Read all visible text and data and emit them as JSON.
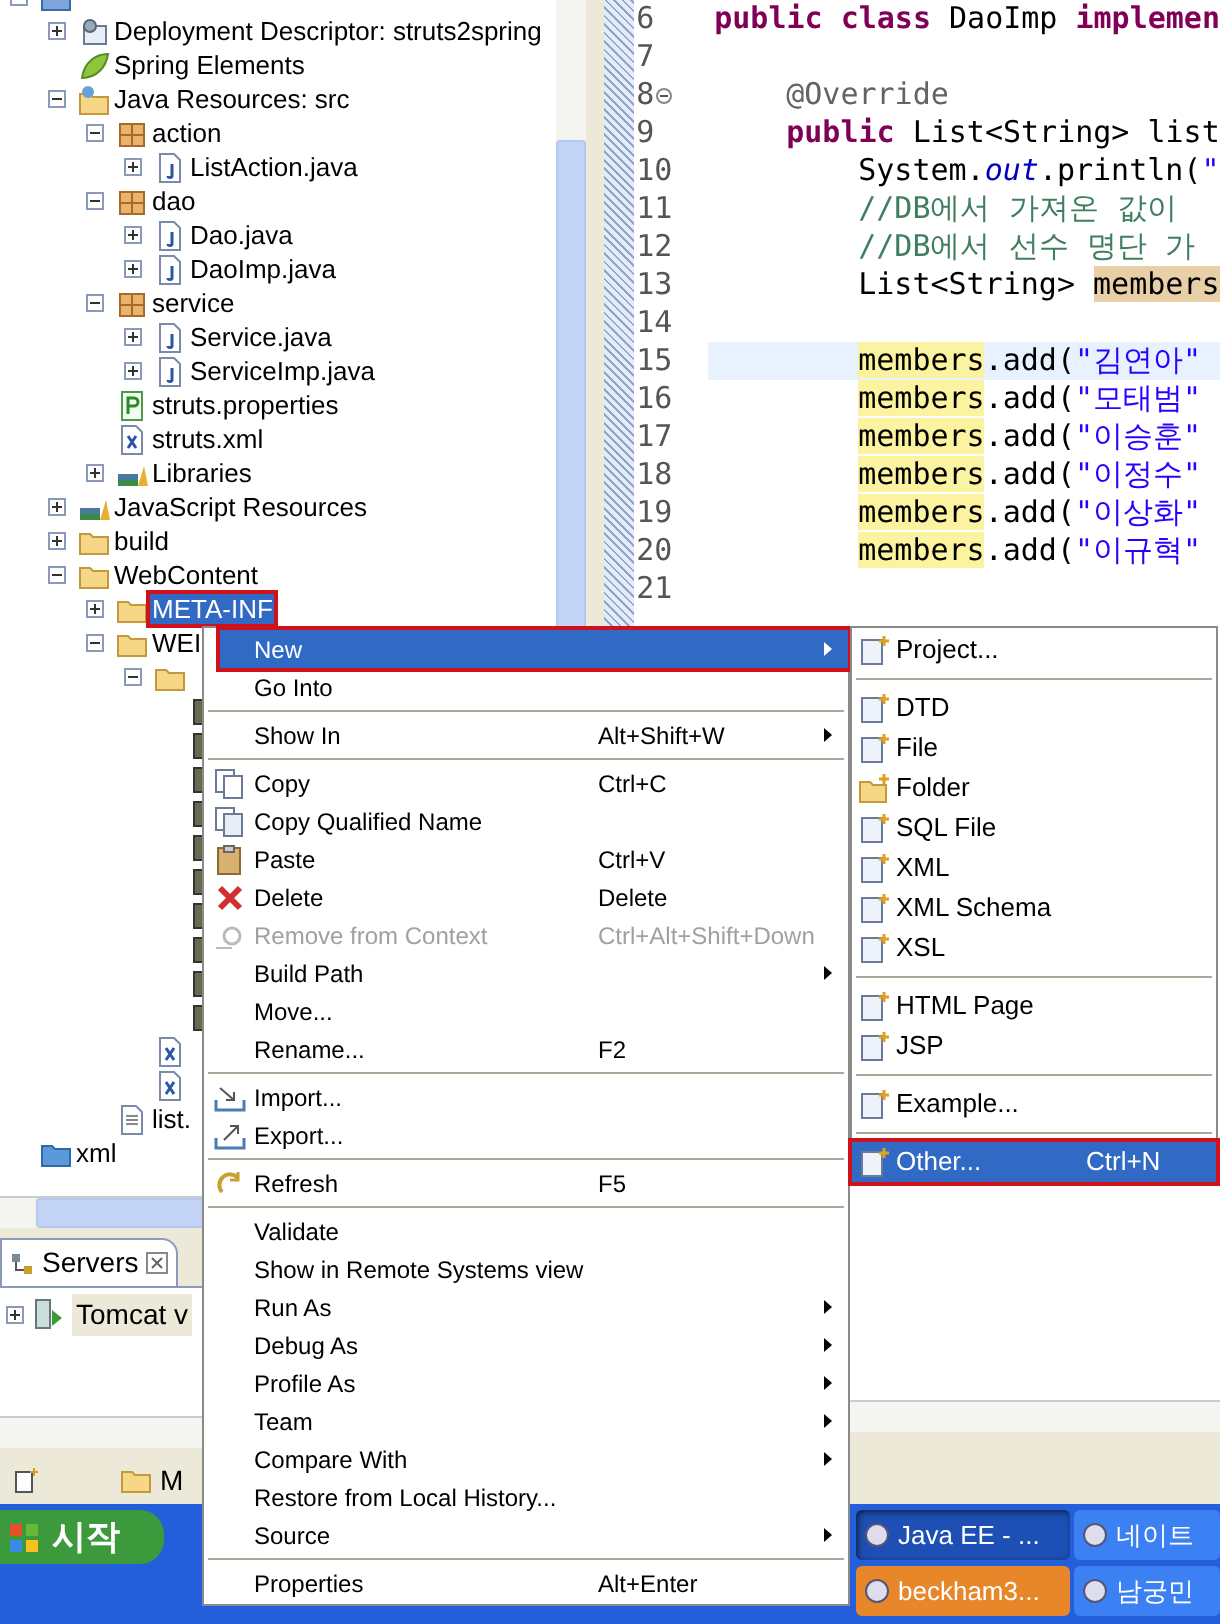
{
  "project_tree": {
    "items": [
      {
        "kind": "project",
        "expanded": true,
        "selected": false,
        "children": [
          {
            "kind": "descriptor",
            "label": "Deployment Descriptor: struts2spring",
            "expanded": false,
            "selected": false
          },
          {
            "kind": "spring",
            "label": "Spring Elements",
            "selected": false
          },
          {
            "kind": "java-resources",
            "label": "Java Resources: src",
            "expanded": true,
            "selected": false,
            "children": [
              {
                "kind": "package",
                "label": "action",
                "expanded": true,
                "selected": false,
                "children": [
                  {
                    "kind": "java-file",
                    "label": "ListAction.java",
                    "expanded": false,
                    "selected": false
                  }
                ]
              },
              {
                "kind": "package",
                "label": "dao",
                "expanded": true,
                "selected": false,
                "children": [
                  {
                    "kind": "java-file",
                    "label": "Dao.java",
                    "expanded": false,
                    "selected": false
                  },
                  {
                    "kind": "java-file",
                    "label": "DaoImp.java",
                    "expanded": false,
                    "selected": false
                  }
                ]
              },
              {
                "kind": "package",
                "label": "service",
                "expanded": true,
                "selected": false,
                "children": [
                  {
                    "kind": "java-file",
                    "label": "Service.java",
                    "expanded": false,
                    "selected": false
                  },
                  {
                    "kind": "java-file",
                    "label": "ServiceImp.java",
                    "expanded": false,
                    "selected": false
                  }
                ]
              },
              {
                "kind": "properties-file",
                "label": "struts.properties",
                "selected": false
              },
              {
                "kind": "xml-file",
                "label": "struts.xml",
                "selected": false
              },
              {
                "kind": "library",
                "label": "Libraries",
                "expanded": false,
                "selected": false
              }
            ]
          },
          {
            "kind": "library",
            "label": "JavaScript Resources",
            "expanded": false,
            "selected": false
          },
          {
            "kind": "folder",
            "label": "build",
            "expanded": false,
            "selected": false
          },
          {
            "kind": "folder",
            "label": "WebContent",
            "expanded": true,
            "selected": false,
            "children": [
              {
                "kind": "folder",
                "label": "META-INF",
                "expanded": false,
                "selected": true
              },
              {
                "kind": "folder",
                "label": "WEI",
                "expanded": true,
                "selected": false,
                "children": [
                  {
                    "kind": "folder",
                    "expanded": true,
                    "selected": false,
                    "children": [
                      {
                        "kind": "library-file",
                        "selected": false
                      },
                      {
                        "kind": "library-file",
                        "selected": false
                      },
                      {
                        "kind": "library-file",
                        "selected": false
                      },
                      {
                        "kind": "library-file",
                        "selected": false
                      },
                      {
                        "kind": "library-file",
                        "selected": false
                      },
                      {
                        "kind": "library-file",
                        "selected": false
                      },
                      {
                        "kind": "library-file",
                        "selected": false
                      },
                      {
                        "kind": "library-file",
                        "selected": false
                      },
                      {
                        "kind": "library-file",
                        "selected": false
                      },
                      {
                        "kind": "library-file",
                        "selected": false
                      }
                    ]
                  },
                  {
                    "kind": "xml-file",
                    "selected": false
                  },
                  {
                    "kind": "xml-file",
                    "selected": false
                  }
                ]
              },
              {
                "kind": "text-file",
                "label": "list.",
                "selected": false
              }
            ]
          }
        ]
      },
      {
        "kind": "project-folder",
        "label": "xml",
        "selected": false
      }
    ]
  },
  "editor": {
    "lines": [
      {
        "number": "6",
        "kind": "class-declaration",
        "current": false,
        "fold_marker": false,
        "segments": [
          {
            "text": "public ",
            "kind": "keyword"
          },
          {
            "text": "class",
            "kind": "keyword"
          },
          {
            "text": " DaoImp ",
            "kind": "plain"
          },
          {
            "text": "implemen",
            "kind": "keyword"
          }
        ]
      },
      {
        "number": "7",
        "kind": "blank",
        "current": false,
        "fold_marker": false
      },
      {
        "number": "8",
        "kind": "member",
        "current": false,
        "fold_marker": true,
        "segments": [
          {
            "text": "@Override",
            "kind": "annotation"
          }
        ]
      },
      {
        "number": "9",
        "kind": "member",
        "current": false,
        "fold_marker": false,
        "segments": [
          {
            "text": "public",
            "kind": "keyword"
          },
          {
            "text": " List<String> list",
            "kind": "plain"
          }
        ]
      },
      {
        "number": "10",
        "kind": "statement",
        "current": false,
        "fold_marker": false,
        "segments": [
          {
            "text": "System.",
            "kind": "plain"
          },
          {
            "text": "out",
            "kind": "static"
          },
          {
            "text": ".println(",
            "kind": "plain"
          },
          {
            "text": "\"",
            "kind": "string"
          }
        ]
      },
      {
        "number": "11",
        "kind": "statement",
        "current": false,
        "fold_marker": false,
        "segments": [
          {
            "text": "//DB에서 가져온 값이",
            "kind": "comment"
          }
        ]
      },
      {
        "number": "12",
        "kind": "statement",
        "current": false,
        "fold_marker": false,
        "segments": [
          {
            "text": "//DB에서 선수 명단 가",
            "kind": "comment"
          }
        ]
      },
      {
        "number": "13",
        "kind": "statement",
        "current": false,
        "fold_marker": false,
        "segments": [
          {
            "text": "List<String> ",
            "kind": "plain"
          },
          {
            "text": "members",
            "kind": "write-occurrence"
          }
        ]
      },
      {
        "number": "14",
        "kind": "blank",
        "current": false,
        "fold_marker": false
      },
      {
        "number": "15",
        "kind": "statement",
        "current": true,
        "fold_marker": false,
        "segments": [
          {
            "text": "members",
            "kind": "occurrence"
          },
          {
            "text": ".add(",
            "kind": "plain"
          },
          {
            "text": "\"김연아\"",
            "kind": "string"
          }
        ]
      },
      {
        "number": "16",
        "kind": "statement",
        "current": false,
        "fold_marker": false,
        "segments": [
          {
            "text": "members",
            "kind": "occurrence"
          },
          {
            "text": ".add(",
            "kind": "plain"
          },
          {
            "text": "\"모태범\"",
            "kind": "string"
          }
        ]
      },
      {
        "number": "17",
        "kind": "statement",
        "current": false,
        "fold_marker": false,
        "segments": [
          {
            "text": "members",
            "kind": "occurrence"
          },
          {
            "text": ".add(",
            "kind": "plain"
          },
          {
            "text": "\"이승훈\"",
            "kind": "string"
          }
        ]
      },
      {
        "number": "18",
        "kind": "statement",
        "current": false,
        "fold_marker": false,
        "segments": [
          {
            "text": "members",
            "kind": "occurrence"
          },
          {
            "text": ".add(",
            "kind": "plain"
          },
          {
            "text": "\"이정수\"",
            "kind": "string"
          }
        ]
      },
      {
        "number": "19",
        "kind": "statement",
        "current": false,
        "fold_marker": false,
        "segments": [
          {
            "text": "members",
            "kind": "occurrence"
          },
          {
            "text": ".add(",
            "kind": "plain"
          },
          {
            "text": "\"이상화\"",
            "kind": "string"
          }
        ]
      },
      {
        "number": "20",
        "kind": "statement",
        "current": false,
        "fold_marker": false,
        "segments": [
          {
            "text": "members",
            "kind": "occurrence"
          },
          {
            "text": ".add(",
            "kind": "plain"
          },
          {
            "text": "\"이규혁\"",
            "kind": "string"
          }
        ]
      },
      {
        "number": "21",
        "kind": "blank",
        "current": false,
        "fold_marker": false
      }
    ]
  },
  "servers_view": {
    "tab": {
      "label": "Servers",
      "selected": true
    },
    "rows": [
      {
        "label": "Tomcat v",
        "expanded": false
      }
    ]
  },
  "bottom_toolbar": {
    "label": "M"
  },
  "context_menu": {
    "items": [
      {
        "kind": "item",
        "label": "New",
        "submenu": true,
        "selected": true,
        "disabled": false
      },
      {
        "kind": "item",
        "label": "Go Into",
        "submenu": false,
        "selected": false,
        "disabled": false
      },
      {
        "kind": "separator"
      },
      {
        "kind": "item",
        "label": "Show In",
        "shortcut": "Alt+Shift+W",
        "submenu": true,
        "selected": false,
        "disabled": false
      },
      {
        "kind": "separator"
      },
      {
        "kind": "item",
        "label": "Copy",
        "shortcut": "Ctrl+C",
        "submenu": false,
        "selected": false,
        "disabled": false
      },
      {
        "kind": "item",
        "label": "Copy Qualified Name",
        "submenu": false,
        "selected": false,
        "disabled": false
      },
      {
        "kind": "item",
        "label": "Paste",
        "shortcut": "Ctrl+V",
        "submenu": false,
        "selected": false,
        "disabled": false
      },
      {
        "kind": "item",
        "label": "Delete",
        "shortcut": "Delete",
        "submenu": false,
        "selected": false,
        "disabled": false
      },
      {
        "kind": "item",
        "label": "Remove from Context",
        "shortcut": "Ctrl+Alt+Shift+Down",
        "submenu": false,
        "selected": false,
        "disabled": true
      },
      {
        "kind": "item",
        "label": "Build Path",
        "submenu": true,
        "selected": false,
        "disabled": false
      },
      {
        "kind": "item",
        "label": "Move...",
        "submenu": false,
        "selected": false,
        "disabled": false
      },
      {
        "kind": "item",
        "label": "Rename...",
        "shortcut": "F2",
        "submenu": false,
        "selected": false,
        "disabled": false
      },
      {
        "kind": "separator"
      },
      {
        "kind": "item",
        "label": "Import...",
        "submenu": false,
        "selected": false,
        "disabled": false
      },
      {
        "kind": "item",
        "label": "Export...",
        "submenu": false,
        "selected": false,
        "disabled": false
      },
      {
        "kind": "separator"
      },
      {
        "kind": "item",
        "label": "Refresh",
        "shortcut": "F5",
        "submenu": false,
        "selected": false,
        "disabled": false
      },
      {
        "kind": "separator"
      },
      {
        "kind": "item",
        "label": "Validate",
        "submenu": false,
        "selected": false,
        "disabled": false
      },
      {
        "kind": "item",
        "label": "Show in Remote Systems view",
        "submenu": false,
        "selected": false,
        "disabled": false
      },
      {
        "kind": "item",
        "label": "Run As",
        "submenu": true,
        "selected": false,
        "disabled": false
      },
      {
        "kind": "item",
        "label": "Debug As",
        "submenu": true,
        "selected": false,
        "disabled": false
      },
      {
        "kind": "item",
        "label": "Profile As",
        "submenu": true,
        "selected": false,
        "disabled": false
      },
      {
        "kind": "item",
        "label": "Team",
        "submenu": true,
        "selected": false,
        "disabled": false
      },
      {
        "kind": "item",
        "label": "Compare With",
        "submenu": true,
        "selected": false,
        "disabled": false
      },
      {
        "kind": "item",
        "label": "Restore from Local History...",
        "submenu": false,
        "selected": false,
        "disabled": false
      },
      {
        "kind": "item",
        "label": "Source",
        "submenu": true,
        "selected": false,
        "disabled": false
      },
      {
        "kind": "separator"
      },
      {
        "kind": "item",
        "label": "Properties",
        "shortcut": "Alt+Enter",
        "submenu": false,
        "selected": false,
        "disabled": false
      }
    ]
  },
  "new_submenu": {
    "items": [
      {
        "kind": "item",
        "label": "Project...",
        "selected": false
      },
      {
        "kind": "separator"
      },
      {
        "kind": "item",
        "label": "DTD",
        "selected": false
      },
      {
        "kind": "item",
        "label": "File",
        "selected": false
      },
      {
        "kind": "item",
        "label": "Folder",
        "selected": false
      },
      {
        "kind": "item",
        "label": "SQL File",
        "selected": false
      },
      {
        "kind": "item",
        "label": "XML",
        "selected": false
      },
      {
        "kind": "item",
        "label": "XML Schema",
        "selected": false
      },
      {
        "kind": "item",
        "label": "XSL",
        "selected": false
      },
      {
        "kind": "separator"
      },
      {
        "kind": "item",
        "label": "HTML Page",
        "selected": false
      },
      {
        "kind": "item",
        "label": "JSP",
        "selected": false
      },
      {
        "kind": "separator"
      },
      {
        "kind": "item",
        "label": "Example...",
        "selected": false
      },
      {
        "kind": "separator"
      },
      {
        "kind": "item",
        "label": "Other...",
        "shortcut": "Ctrl+N",
        "selected": true
      }
    ]
  },
  "taskbar": {
    "start_button": "시작",
    "tasks": [
      {
        "label": "Java EE - ...",
        "selected": true,
        "flashing": false
      },
      {
        "label": "네이트",
        "selected": false,
        "flashing": false
      },
      {
        "label": "beckham3...",
        "selected": false,
        "flashing": true
      },
      {
        "label": "남궁민",
        "selected": false,
        "flashing": false
      }
    ]
  }
}
